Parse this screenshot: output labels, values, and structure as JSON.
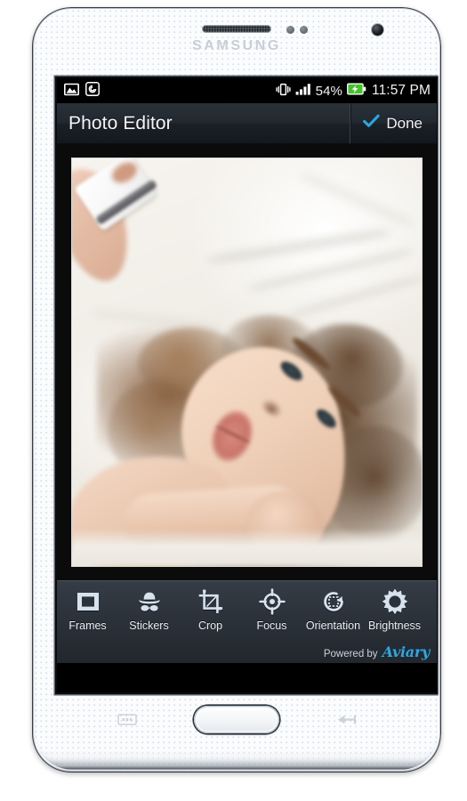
{
  "device": {
    "brand": "SAMSUNG",
    "hardware": {
      "earpiece": "earpiece-speaker",
      "front_camera": "front-camera",
      "sensor_1": "proximity-sensor",
      "sensor_2": "light-sensor",
      "home_button": "home-button",
      "recents_key": "recent-apps-key",
      "back_key": "back-key"
    }
  },
  "statusbar": {
    "left_icons": [
      "gallery-icon",
      "screenshot-icon"
    ],
    "right_icons": [
      "vibrate-icon",
      "signal-bars-icon",
      "battery-charging-icon"
    ],
    "battery_percent": "54%",
    "clock": "11:57 PM"
  },
  "titlebar": {
    "title": "Photo Editor",
    "done_label": "Done",
    "done_icon": "check-icon",
    "accent_color": "#29a8e0"
  },
  "canvas": {
    "photo_alt": "Woman with curly brown hair lying on white bedding taking a selfie"
  },
  "toolbar": {
    "tools": [
      {
        "label": "Frames",
        "icon": "frames-stamp-icon"
      },
      {
        "label": "Stickers",
        "icon": "stickers-hat-mustache-icon"
      },
      {
        "label": "Crop",
        "icon": "crop-icon"
      },
      {
        "label": "Focus",
        "icon": "focus-target-icon"
      },
      {
        "label": "Orientation",
        "icon": "orientation-rotate-icon"
      },
      {
        "label": "Brightness",
        "icon": "brightness-sun-icon"
      }
    ],
    "powered_by_text": "Powered by",
    "powered_by_brand": "Aviary",
    "brand_color": "#2ea7e0"
  }
}
